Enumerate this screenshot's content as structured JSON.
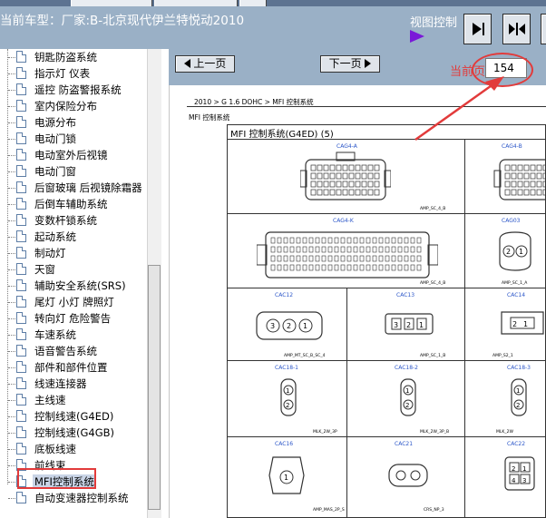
{
  "window": {
    "vehicle_label": "当前车型：厂家:B-北京现代伊兰特悦动2010",
    "view_control_label": "视图控制",
    "view_buttons": [
      "next-page-view",
      "fit-split-view",
      "third-view"
    ]
  },
  "tree": {
    "items": [
      "钥匙防盗系统",
      "指示灯 仪表",
      "遥控 防盗警报系统",
      "室内保险分布",
      "电源分布",
      "电动门锁",
      "电动室外后视镜",
      "电动门窗",
      "后窗玻璃 后视镜除霜器",
      "后倒车辅助系统",
      "变数杆锁系统",
      "起动系统",
      "制动灯",
      "天窗",
      "辅助安全系统(SRS)",
      "尾灯 小灯 牌照灯",
      "转向灯 危险警告",
      "车速系统",
      "语音警告系统",
      "部件和部件位置",
      "线速连接器",
      "主线速",
      "控制线速(G4ED)",
      "控制线速(G4GB)",
      "底板线速",
      "前线束",
      "MFI控制系统",
      "自动变速器控制系统"
    ],
    "selected_label": "MFI控制系统"
  },
  "nav": {
    "prev_label": "上一页",
    "next_label": "下一页",
    "current_page_label": "当前页",
    "current_page_value": "154"
  },
  "document": {
    "breadcrumb": "2010 > G 1.6 DOHC > MFI 控制系统",
    "section_title": "MFI 控制系统",
    "diagram_title": "MFI 控制系统(G4ED) (5)",
    "connectors": [
      {
        "label": "CAG4-A",
        "foot": "AMP_SC_4_B"
      },
      {
        "label": "CAG4-B",
        "foot": ""
      },
      {
        "label": "CAG4-K",
        "foot": "AMP_SC_4_B"
      },
      {
        "label": "CAG03",
        "foot": "AMP_SC_1_A"
      },
      {
        "label": "CAC12",
        "foot": "AMP_MT_SC_B_SC_4"
      },
      {
        "label": "CAC13",
        "foot": "AMP_SC_1_B"
      },
      {
        "label": "CAC14",
        "foot": "AMP_S2_1"
      },
      {
        "label": "CAC18-1",
        "foot": "MLK_2W_3P"
      },
      {
        "label": "CAC18-2",
        "foot": "MLK_2W_3P_B"
      },
      {
        "label": "CAC18-3",
        "foot": "MLK_2W"
      },
      {
        "label": "CAC16",
        "foot": "AMP_MAS_2P_S"
      },
      {
        "label": "CAC21",
        "foot": "CRS_NP_3"
      },
      {
        "label": "CAC22",
        "foot": ""
      }
    ]
  },
  "colors": {
    "toolbar_bg": "#9ab0c6",
    "highlight_red": "#e23b3b",
    "connector_label_blue": "#2a55c8",
    "view_arrow_purple": "#7a18d8"
  }
}
